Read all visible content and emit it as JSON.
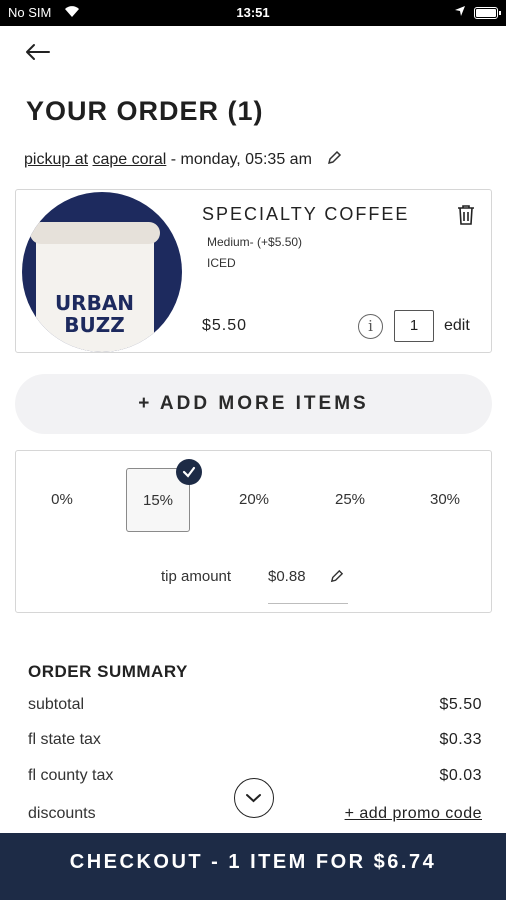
{
  "status_bar": {
    "carrier": "No SIM",
    "time": "13:51"
  },
  "header": {
    "title": "YOUR ORDER (1)"
  },
  "pickup": {
    "prefix": "pickup at",
    "location": "cape coral",
    "datetime": "- monday, 05:35 am"
  },
  "item": {
    "name": "SPECIALTY COFFEE",
    "size": "Medium- (+$5.50)",
    "option": "ICED",
    "price": "$5.50",
    "quantity": "1",
    "edit_label": "edit",
    "cup_text": "URBAN BUZZ"
  },
  "add_more_label": "+ ADD MORE ITEMS",
  "tip": {
    "options": [
      "0%",
      "15%",
      "20%",
      "25%",
      "30%"
    ],
    "selected": "15%",
    "amount_label": "tip amount",
    "amount_value": "$0.88"
  },
  "summary": {
    "title": "ORDER SUMMARY",
    "rows": [
      {
        "label": "subtotal",
        "value": "$5.50"
      },
      {
        "label": "fl state tax",
        "value": "$0.33"
      },
      {
        "label": "fl county tax",
        "value": "$0.03"
      },
      {
        "label": "discounts",
        "value": "+ add promo code"
      }
    ]
  },
  "checkout_label": "CHECKOUT - 1 ITEM FOR $6.74",
  "colors": {
    "primary": "#1d2b46",
    "pill_bg": "#f2f2f4",
    "border": "#d6d6d6"
  }
}
